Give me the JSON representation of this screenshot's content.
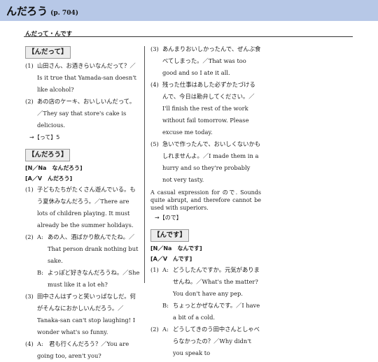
{
  "header": {
    "title": "んだろう",
    "page_ref": "(p. 704)"
  },
  "subheading": "んだって・んです",
  "left": {
    "sec1": {
      "heading": "んだって",
      "ex1": {
        "num": "(1)",
        "jp": "山田さん、お酒きらいなんだって？／Is it true that Yamada-san doesn't like alcohol?"
      },
      "ex2": {
        "num": "(2)",
        "jp": "あの店のケーキ、おいしいんだって。／They say that store's cake is delicious."
      },
      "xref": "→【って】5"
    },
    "sec2": {
      "heading": "んだろう",
      "pat1": "[N／Na　なんだろう]",
      "pat2": "[A／V　んだろう]",
      "ex1": {
        "num": "(1)",
        "text": "子どもたちがたくさん遊んでいる。もう夏休みなんだろう。／There are lots of children playing. It must already be the summer holidays."
      },
      "ex2": {
        "num": "(2)",
        "a_spk": "A:",
        "a_text": "あの人、酒ばかり飲んでたね。／That person drank nothing but sake.",
        "b_spk": "B:",
        "b_text": "よっぽど好きなんだろうね。／She must like it a lot eh?"
      },
      "ex3": {
        "num": "(3)",
        "text": "田中さんはずっと笑いっぱなしだ。何がそんなにおかしいんだろう。／Tanaka-san can't stop laughing! I wonder what's so funny."
      },
      "ex4": {
        "num": "(4)",
        "text": "A:　君も行くんだろう？／You are going too, aren't you?"
      }
    }
  },
  "right": {
    "ex3": {
      "num": "(3)",
      "text": "あんまりおいしかったんで、ぜんぶ食べてしまった。／That was too good and so I ate it all."
    },
    "ex4": {
      "num": "(4)",
      "text": "残った仕事はあした必ずかたづけるんで、今日は勘弁してください。／I'll finish the rest of the work without fail tomorrow. Please excuse me today."
    },
    "ex5": {
      "num": "(5)",
      "text": "急いで作ったんで、おいしくないかもしれませんよ。／I made them in a hurry and so they're probably not very tasty."
    },
    "note": "A casual expression for ので. Sounds quite abrupt, and therefore cannot be used with superiors.",
    "xref": "→【ので】",
    "sec3": {
      "heading": "んです",
      "pat1": "[N／Na　なんです]",
      "pat2": "[A／V　んです]",
      "ex1": {
        "num": "(1)",
        "a_spk": "A:",
        "a_text": "どうしたんですか。元気がありませんね。／What's the matter? You don't have any pep.",
        "b_spk": "B:",
        "b_text": "ちょっとかぜなんです。／I have a bit of a cold."
      },
      "ex2": {
        "num": "(2)",
        "a_spk": "A:",
        "a_text": "どうしてきのう田中さんとしゃべらなかったの？／Why didn't you speak to"
      }
    }
  }
}
